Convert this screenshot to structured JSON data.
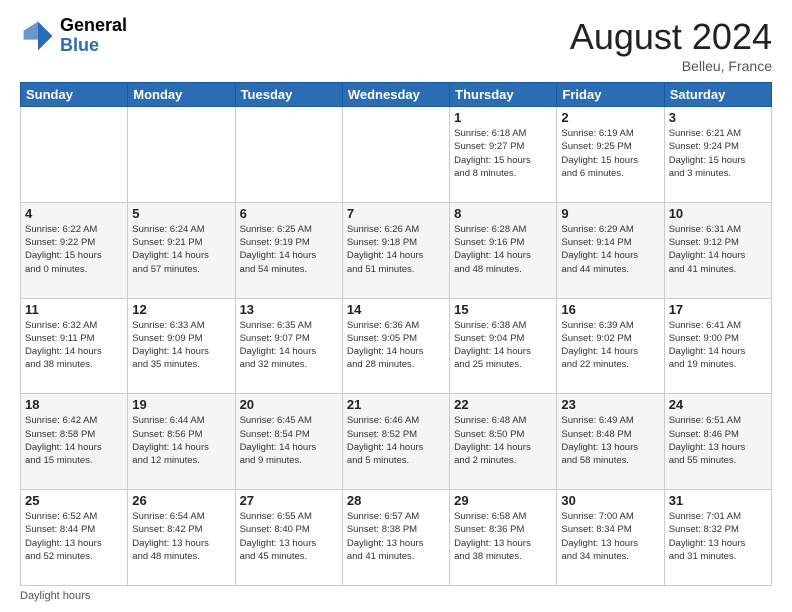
{
  "header": {
    "logo_general": "General",
    "logo_blue": "Blue",
    "month_title": "August 2024",
    "location": "Belleu, France"
  },
  "days_of_week": [
    "Sunday",
    "Monday",
    "Tuesday",
    "Wednesday",
    "Thursday",
    "Friday",
    "Saturday"
  ],
  "weeks": [
    [
      {
        "day": "",
        "info": ""
      },
      {
        "day": "",
        "info": ""
      },
      {
        "day": "",
        "info": ""
      },
      {
        "day": "",
        "info": ""
      },
      {
        "day": "1",
        "info": "Sunrise: 6:18 AM\nSunset: 9:27 PM\nDaylight: 15 hours\nand 8 minutes."
      },
      {
        "day": "2",
        "info": "Sunrise: 6:19 AM\nSunset: 9:25 PM\nDaylight: 15 hours\nand 6 minutes."
      },
      {
        "day": "3",
        "info": "Sunrise: 6:21 AM\nSunset: 9:24 PM\nDaylight: 15 hours\nand 3 minutes."
      }
    ],
    [
      {
        "day": "4",
        "info": "Sunrise: 6:22 AM\nSunset: 9:22 PM\nDaylight: 15 hours\nand 0 minutes."
      },
      {
        "day": "5",
        "info": "Sunrise: 6:24 AM\nSunset: 9:21 PM\nDaylight: 14 hours\nand 57 minutes."
      },
      {
        "day": "6",
        "info": "Sunrise: 6:25 AM\nSunset: 9:19 PM\nDaylight: 14 hours\nand 54 minutes."
      },
      {
        "day": "7",
        "info": "Sunrise: 6:26 AM\nSunset: 9:18 PM\nDaylight: 14 hours\nand 51 minutes."
      },
      {
        "day": "8",
        "info": "Sunrise: 6:28 AM\nSunset: 9:16 PM\nDaylight: 14 hours\nand 48 minutes."
      },
      {
        "day": "9",
        "info": "Sunrise: 6:29 AM\nSunset: 9:14 PM\nDaylight: 14 hours\nand 44 minutes."
      },
      {
        "day": "10",
        "info": "Sunrise: 6:31 AM\nSunset: 9:12 PM\nDaylight: 14 hours\nand 41 minutes."
      }
    ],
    [
      {
        "day": "11",
        "info": "Sunrise: 6:32 AM\nSunset: 9:11 PM\nDaylight: 14 hours\nand 38 minutes."
      },
      {
        "day": "12",
        "info": "Sunrise: 6:33 AM\nSunset: 9:09 PM\nDaylight: 14 hours\nand 35 minutes."
      },
      {
        "day": "13",
        "info": "Sunrise: 6:35 AM\nSunset: 9:07 PM\nDaylight: 14 hours\nand 32 minutes."
      },
      {
        "day": "14",
        "info": "Sunrise: 6:36 AM\nSunset: 9:05 PM\nDaylight: 14 hours\nand 28 minutes."
      },
      {
        "day": "15",
        "info": "Sunrise: 6:38 AM\nSunset: 9:04 PM\nDaylight: 14 hours\nand 25 minutes."
      },
      {
        "day": "16",
        "info": "Sunrise: 6:39 AM\nSunset: 9:02 PM\nDaylight: 14 hours\nand 22 minutes."
      },
      {
        "day": "17",
        "info": "Sunrise: 6:41 AM\nSunset: 9:00 PM\nDaylight: 14 hours\nand 19 minutes."
      }
    ],
    [
      {
        "day": "18",
        "info": "Sunrise: 6:42 AM\nSunset: 8:58 PM\nDaylight: 14 hours\nand 15 minutes."
      },
      {
        "day": "19",
        "info": "Sunrise: 6:44 AM\nSunset: 8:56 PM\nDaylight: 14 hours\nand 12 minutes."
      },
      {
        "day": "20",
        "info": "Sunrise: 6:45 AM\nSunset: 8:54 PM\nDaylight: 14 hours\nand 9 minutes."
      },
      {
        "day": "21",
        "info": "Sunrise: 6:46 AM\nSunset: 8:52 PM\nDaylight: 14 hours\nand 5 minutes."
      },
      {
        "day": "22",
        "info": "Sunrise: 6:48 AM\nSunset: 8:50 PM\nDaylight: 14 hours\nand 2 minutes."
      },
      {
        "day": "23",
        "info": "Sunrise: 6:49 AM\nSunset: 8:48 PM\nDaylight: 13 hours\nand 58 minutes."
      },
      {
        "day": "24",
        "info": "Sunrise: 6:51 AM\nSunset: 8:46 PM\nDaylight: 13 hours\nand 55 minutes."
      }
    ],
    [
      {
        "day": "25",
        "info": "Sunrise: 6:52 AM\nSunset: 8:44 PM\nDaylight: 13 hours\nand 52 minutes."
      },
      {
        "day": "26",
        "info": "Sunrise: 6:54 AM\nSunset: 8:42 PM\nDaylight: 13 hours\nand 48 minutes."
      },
      {
        "day": "27",
        "info": "Sunrise: 6:55 AM\nSunset: 8:40 PM\nDaylight: 13 hours\nand 45 minutes."
      },
      {
        "day": "28",
        "info": "Sunrise: 6:57 AM\nSunset: 8:38 PM\nDaylight: 13 hours\nand 41 minutes."
      },
      {
        "day": "29",
        "info": "Sunrise: 6:58 AM\nSunset: 8:36 PM\nDaylight: 13 hours\nand 38 minutes."
      },
      {
        "day": "30",
        "info": "Sunrise: 7:00 AM\nSunset: 8:34 PM\nDaylight: 13 hours\nand 34 minutes."
      },
      {
        "day": "31",
        "info": "Sunrise: 7:01 AM\nSunset: 8:32 PM\nDaylight: 13 hours\nand 31 minutes."
      }
    ]
  ],
  "footer": {
    "label": "Daylight hours"
  }
}
